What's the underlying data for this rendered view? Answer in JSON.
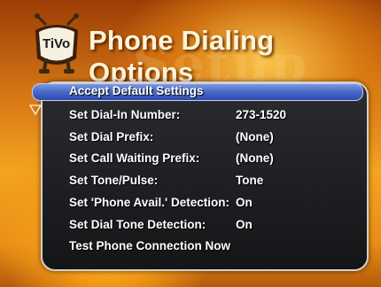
{
  "header": {
    "title": "Phone Dialing Options",
    "background_watermark": "Setup",
    "logo_text": "TiVo"
  },
  "menu": {
    "items": [
      {
        "label": "Accept Default Settings",
        "value": "",
        "selected": true
      },
      {
        "label": "Set Dial-In Number:",
        "value": "273-1520"
      },
      {
        "label": "Set Dial Prefix:",
        "value": "(None)"
      },
      {
        "label": "Set Call Waiting Prefix:",
        "value": "(None)"
      },
      {
        "label": "Set Tone/Pulse:",
        "value": "Tone"
      },
      {
        "label": "Set 'Phone Avail.' Detection:",
        "value": "On"
      },
      {
        "label": "Set Dial Tone Detection:",
        "value": "On"
      },
      {
        "label": "Test Phone Connection Now",
        "value": ""
      }
    ]
  },
  "icons": {
    "left": "left-arrow-icon",
    "right": "right-arrow-icon",
    "down": "down-arrow-icon"
  },
  "colors": {
    "title": "#fff3d6",
    "highlight": "#4667c7",
    "panel": "#1e1f22"
  }
}
